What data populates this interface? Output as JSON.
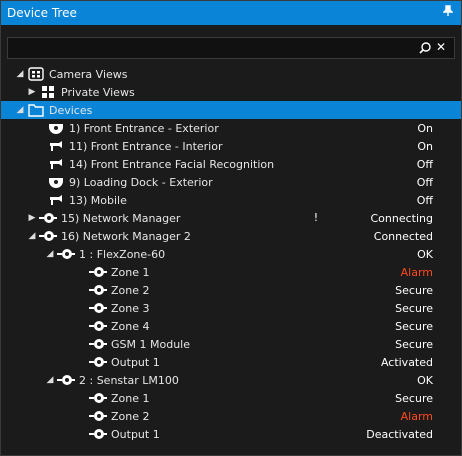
{
  "panel": {
    "title": "Device Tree",
    "pin_icon": "pin-icon"
  },
  "search": {
    "value": "",
    "placeholder": "",
    "icon": "search-icon",
    "clear_icon": "close-icon"
  },
  "tree": {
    "camera_views": "Camera Views",
    "private_views": "Private Views",
    "devices": "Devices",
    "cameras": [
      {
        "label": "1) Front Entrance - Exterior",
        "status": "On"
      },
      {
        "label": "11) Front Entrance - Interior",
        "status": "On"
      },
      {
        "label": "14) Front Entrance Facial Recognition",
        "status": "Off"
      },
      {
        "label": "9) Loading Dock - Exterior",
        "status": "Off"
      },
      {
        "label": "13) Mobile",
        "status": "Off"
      }
    ],
    "network_manager_15": {
      "label": "15) Network Manager",
      "flag": "!",
      "status": "Connecting"
    },
    "network_manager_16": {
      "label": "16) Network Manager 2",
      "status": "Connected"
    },
    "flexzone": {
      "label": "1 : FlexZone-60",
      "status": "OK"
    },
    "flexzone_items": [
      {
        "label": "Zone 1",
        "status": "Alarm"
      },
      {
        "label": "Zone 2",
        "status": "Secure"
      },
      {
        "label": "Zone 3",
        "status": "Secure"
      },
      {
        "label": "Zone 4",
        "status": "Secure"
      },
      {
        "label": "GSM 1 Module",
        "status": "Secure"
      },
      {
        "label": "Output 1",
        "status": "Activated"
      }
    ],
    "senstar": {
      "label": "2 : Senstar LM100",
      "status": "OK"
    },
    "senstar_items": [
      {
        "label": "Zone 1",
        "status": "Secure"
      },
      {
        "label": "Zone 2",
        "status": "Alarm"
      },
      {
        "label": "Output 1",
        "status": "Deactivated"
      }
    ]
  },
  "colors": {
    "title_bar": "#0a84d6",
    "selected": "#0a84d6",
    "alarm": "#ff4a1a",
    "background": "#1b1b1b"
  }
}
